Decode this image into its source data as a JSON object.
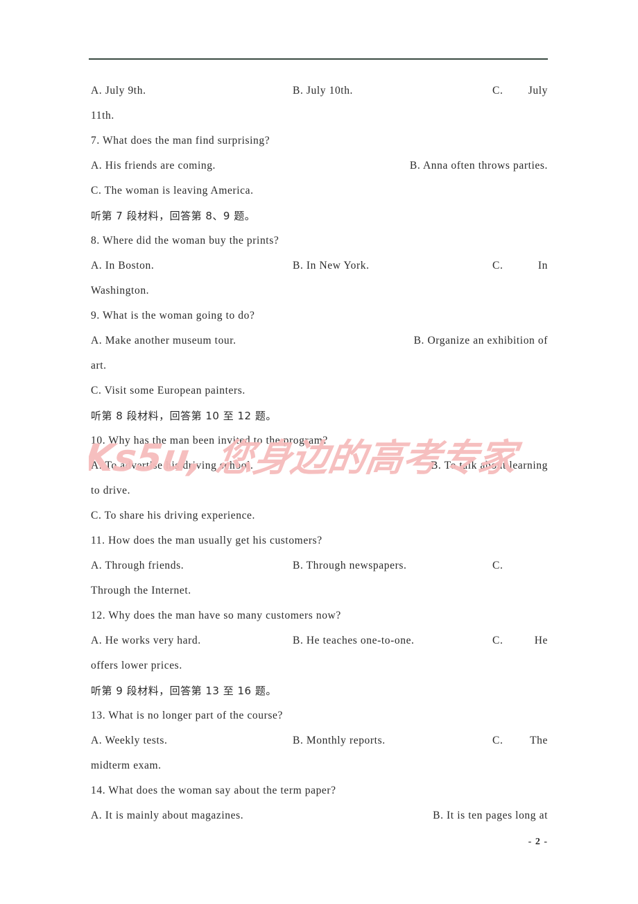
{
  "document": {
    "page_number": "- 2 -",
    "header_rule": true,
    "watermark_text": "Ks5u, 您身边的高考专家",
    "watermark_color": "#f6bcbc",
    "text_color": "#2a2a2a"
  },
  "lines": [
    {
      "id": "q6-options",
      "type": "options",
      "a": "A. July 9th.",
      "b": "B. July 10th.",
      "c": "C.",
      "c_tail": "July"
    },
    {
      "id": "q6-options-cont",
      "type": "plain",
      "text": "11th."
    },
    {
      "id": "q7-stem",
      "type": "plain",
      "text": "7. What does the man find surprising?"
    },
    {
      "id": "q7-options-ab",
      "type": "two-col",
      "a": "A. His friends are coming.",
      "b": "B. Anna often throws parties."
    },
    {
      "id": "q7-option-c",
      "type": "plain",
      "text": "C. The woman is leaving America."
    },
    {
      "id": "zh-part7",
      "type": "chinese",
      "text": "听第 7 段材料，回答第 8、9 题。"
    },
    {
      "id": "q8-stem",
      "type": "plain",
      "text": "8. Where did the woman buy the prints?"
    },
    {
      "id": "q8-options",
      "type": "options",
      "a": "A. In Boston.",
      "b": "B. In New York.",
      "c": "C.",
      "c_tail": "In"
    },
    {
      "id": "q8-options-cont",
      "type": "plain",
      "text": "Washington."
    },
    {
      "id": "q9-stem",
      "type": "plain",
      "text": "9. What is the woman going to do?"
    },
    {
      "id": "q9-options-ab",
      "type": "two-col",
      "a": "A. Make another museum tour.",
      "b": "B. Organize an exhibition of"
    },
    {
      "id": "q9-options-cont",
      "type": "plain",
      "text": "art."
    },
    {
      "id": "q9-option-c",
      "type": "plain",
      "text": "C. Visit some European painters."
    },
    {
      "id": "zh-part8",
      "type": "chinese",
      "text": "听第 8 段材料，回答第 10 至 12 题。"
    },
    {
      "id": "q10-stem",
      "type": "plain",
      "text": "10. Why has the man been invited to the program?"
    },
    {
      "id": "q10-options-ab",
      "type": "two-col",
      "a": "A. To advertise his driving school.",
      "b": "B. To talk about learning"
    },
    {
      "id": "q10-options-cont",
      "type": "plain",
      "text": "to drive."
    },
    {
      "id": "q10-option-c",
      "type": "plain",
      "text": "C. To share his driving experience."
    },
    {
      "id": "q11-stem",
      "type": "plain",
      "text": "11. How does the man usually get his customers?"
    },
    {
      "id": "q11-options",
      "type": "options-narrow",
      "a": "A. Through friends.",
      "b": "B. Through newspapers.",
      "c": "C."
    },
    {
      "id": "q11-options-cont",
      "type": "plain",
      "text": "Through the Internet."
    },
    {
      "id": "q12-stem",
      "type": "plain",
      "text": "12. Why does the man have so many customers now?"
    },
    {
      "id": "q12-options",
      "type": "options-narrow2",
      "a": "A. He works very hard.",
      "b": "B. He teaches one-to-one.",
      "c": "C.",
      "c_tail": "He"
    },
    {
      "id": "q12-options-cont",
      "type": "plain",
      "text": "offers lower prices."
    },
    {
      "id": "zh-part9",
      "type": "chinese",
      "text": "听第 9 段材料，回答第 13 至 16 题。"
    },
    {
      "id": "q13-stem",
      "type": "plain",
      "text": "13. What is no longer part of the course?"
    },
    {
      "id": "q13-options",
      "type": "options",
      "a": "A. Weekly tests.",
      "b": "B. Monthly reports.",
      "c": "C.",
      "c_tail": "The"
    },
    {
      "id": "q13-options-cont",
      "type": "plain",
      "text": "midterm exam."
    },
    {
      "id": "q14-stem",
      "type": "plain",
      "text": "14. What does the woman say about the term paper?"
    },
    {
      "id": "q14-options-ab",
      "type": "two-col",
      "a": "A. It is mainly about magazines.",
      "b": "B. It is ten pages long at"
    }
  ]
}
